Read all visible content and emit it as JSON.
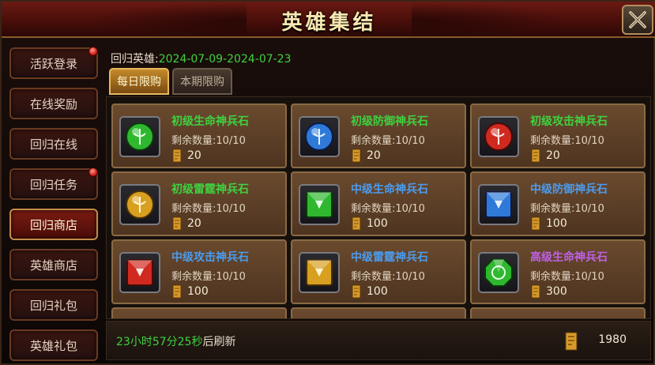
{
  "header": {
    "title": "英雄集结"
  },
  "sidebar": {
    "items": [
      {
        "label": "活跃登录",
        "badge": true,
        "active": false
      },
      {
        "label": "在线奖励",
        "badge": false,
        "active": false
      },
      {
        "label": "回归在线",
        "badge": false,
        "active": false
      },
      {
        "label": "回归任务",
        "badge": true,
        "active": false
      },
      {
        "label": "回归商店",
        "badge": false,
        "active": true
      },
      {
        "label": "英雄商店",
        "badge": false,
        "active": false
      },
      {
        "label": "回归礼包",
        "badge": false,
        "active": false
      },
      {
        "label": "英雄礼包",
        "badge": false,
        "active": false
      }
    ]
  },
  "event": {
    "label": "回归英雄:",
    "dates": "2024-07-09-2024-07-23"
  },
  "tabs": [
    {
      "label": "每日限购",
      "active": true
    },
    {
      "label": "本期限购",
      "active": false
    }
  ],
  "shop": {
    "items": [
      {
        "name": "初级生命神兵石",
        "stock": "剩余数量:10/10",
        "price": "20",
        "gem_color": "#2fb82f",
        "name_color": "#3fd23f",
        "icon": "round-green-gem-icon"
      },
      {
        "name": "初级防御神兵石",
        "stock": "剩余数量:10/10",
        "price": "20",
        "gem_color": "#2f7ad8",
        "name_color": "#3fd23f",
        "icon": "round-blue-gem-icon"
      },
      {
        "name": "初级攻击神兵石",
        "stock": "剩余数量:10/10",
        "price": "20",
        "gem_color": "#d02a20",
        "name_color": "#3fd23f",
        "icon": "round-red-gem-icon"
      },
      {
        "name": "初级雷霆神兵石",
        "stock": "剩余数量:10/10",
        "price": "20",
        "gem_color": "#d8a020",
        "name_color": "#3fd23f",
        "icon": "round-yellow-gem-icon"
      },
      {
        "name": "中级生命神兵石",
        "stock": "剩余数量:10/10",
        "price": "100",
        "gem_color": "#2fb82f",
        "name_color": "#4a9cf0",
        "icon": "square-green-gem-icon"
      },
      {
        "name": "中级防御神兵石",
        "stock": "剩余数量:10/10",
        "price": "100",
        "gem_color": "#2f7ad8",
        "name_color": "#4a9cf0",
        "icon": "square-blue-gem-icon"
      },
      {
        "name": "中级攻击神兵石",
        "stock": "剩余数量:10/10",
        "price": "100",
        "gem_color": "#d02a20",
        "name_color": "#4a9cf0",
        "icon": "square-red-gem-icon"
      },
      {
        "name": "中级雷霆神兵石",
        "stock": "剩余数量:10/10",
        "price": "100",
        "gem_color": "#d8a020",
        "name_color": "#4a9cf0",
        "icon": "square-yellow-gem-icon"
      },
      {
        "name": "高级生命神兵石",
        "stock": "剩余数量:10/10",
        "price": "300",
        "gem_color": "#2fb82f",
        "name_color": "#c060e8",
        "icon": "octagon-green-gem-icon"
      }
    ]
  },
  "footer": {
    "refresh_time": "23小时57分25秒",
    "refresh_suffix": "后刷新",
    "balance": "1980"
  },
  "colors": {
    "accent_gold": "#e8b860",
    "green_text": "#3fd23f"
  }
}
